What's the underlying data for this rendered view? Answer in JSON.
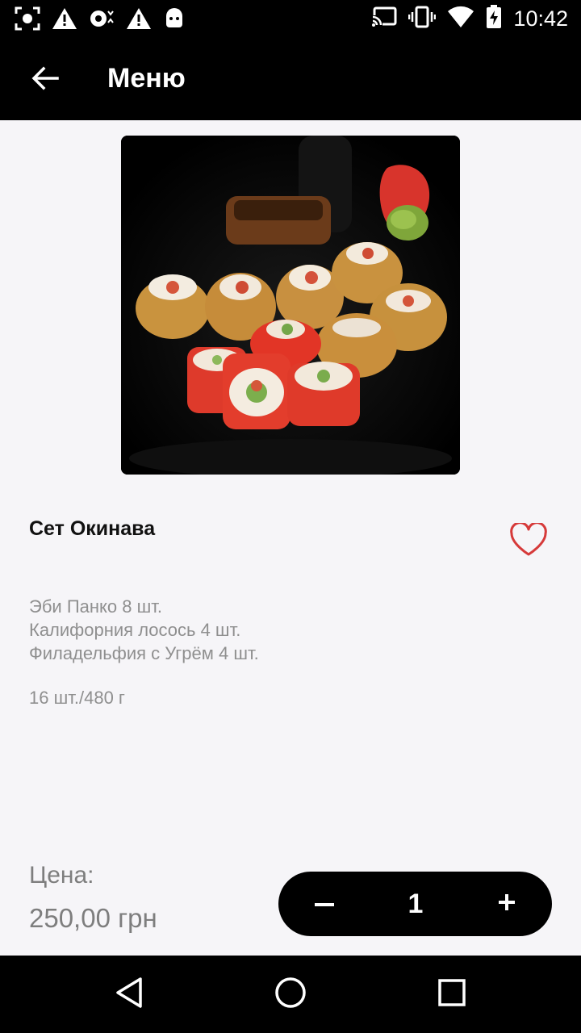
{
  "status_bar": {
    "time": "10:42",
    "left_icons": [
      "screenshot-icon",
      "warning-icon",
      "cast-warning-icon",
      "warning-icon",
      "android-icon"
    ],
    "right_icons": [
      "cast-icon",
      "vibrate-icon",
      "wifi-icon",
      "battery-charging-icon"
    ]
  },
  "app_bar": {
    "title": "Меню",
    "back_icon": "arrow-back-icon"
  },
  "product": {
    "name": "Сет Окинава",
    "description": [
      "Эби Панко 8 шт.",
      "Калифорния лосось 4 шт.",
      "Филадельфия с Угрём 4 шт."
    ],
    "weight": "16 шт./480 г",
    "favorite_icon": "heart-outline-icon",
    "favorite_color": "#d63a3a"
  },
  "price": {
    "label": "Цена:",
    "value": "250,00 грн"
  },
  "quantity": {
    "minus_label": "−",
    "value": "1",
    "plus_label": "+"
  },
  "nav_bar": {
    "icons": [
      "back-triangle-icon",
      "home-circle-icon",
      "recents-square-icon"
    ]
  }
}
